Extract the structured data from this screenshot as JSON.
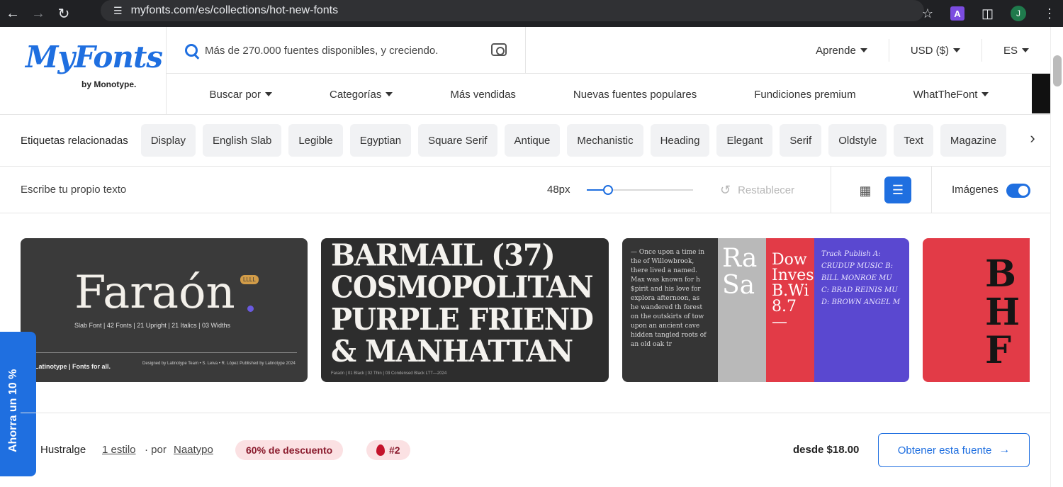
{
  "browser": {
    "url": "myfonts.com/es/collections/hot-new-fonts",
    "extension_letter": "A",
    "profile_initial": "J"
  },
  "header": {
    "logo": "MyFonts",
    "logo_sub": "by Monotype.",
    "search_placeholder": "Más de 270.000 fuentes disponibles, y creciendo.",
    "top_menu": [
      "Aprende",
      "USD ($)",
      "ES"
    ],
    "nav": [
      {
        "label": "Buscar por",
        "caret": true
      },
      {
        "label": "Categorías",
        "caret": true
      },
      {
        "label": "Más vendidas",
        "caret": false
      },
      {
        "label": "Nuevas fuentes populares",
        "caret": false
      },
      {
        "label": "Fundiciones premium",
        "caret": false
      },
      {
        "label": "WhatTheFont",
        "caret": true
      }
    ]
  },
  "tags": {
    "label": "Etiquetas relacionadas",
    "items": [
      "Display",
      "English Slab",
      "Legible",
      "Egyptian",
      "Square Serif",
      "Antique",
      "Mechanistic",
      "Heading",
      "Elegant",
      "Serif",
      "Oldstyle",
      "Text",
      "Magazine"
    ]
  },
  "controls": {
    "own_text_placeholder": "Escribe tu propio texto",
    "size_label": "48px",
    "size_fraction": 0.2,
    "reset_label": "Restablecer",
    "images_label": "Imágenes",
    "images_on": true
  },
  "cards": {
    "card1": {
      "title": "Faraón",
      "badge": "LLLL",
      "meta": "Slab Font  |  42 Fonts  |  21 Upright  |  21 Italics  |  03 Widths",
      "foot": "Latinotype | Fonts for all.",
      "foot2": "Designed by  Latinotype Team • S. Leiva • R. López      Published by  Latinotype      2024"
    },
    "card2": {
      "lines": [
        "BARMAIL (37)",
        "COSMOPOLITAN",
        "PURPLE FRIEND",
        "& MANHATTAN"
      ],
      "foot": "Faraón   |   01 Black   |   02 Thin   |   03 Condensed Black                LTT—2024"
    },
    "card3": {
      "p1": "— Once upon a time in the of Willowbrook, there lived a named. Max was known for h $pirit and his love for explora afternoon, as he wandered th forest on the outskirts of tow upon an ancient cave hidden tangled roots of an old oak tr",
      "p2": "Ra Sa",
      "p3": "Dow Inves B.Wi 8.7—",
      "p4": "Track Publish A: CRUDUP MUSIC B: BILL MONROE MU C: BRAD REINIS MU D: BROWN ANGEL M"
    },
    "card4": {
      "text": "B H F"
    }
  },
  "promo": {
    "label": "Ahorra un 10 %"
  },
  "font_row": {
    "name": "Hustralge",
    "styles": "1 estilo",
    "by": "· por",
    "foundry": "Naatypo",
    "discount": "60% de descuento",
    "rank": "#2",
    "price": "desde $18.00",
    "cta": "Obtener esta fuente"
  }
}
